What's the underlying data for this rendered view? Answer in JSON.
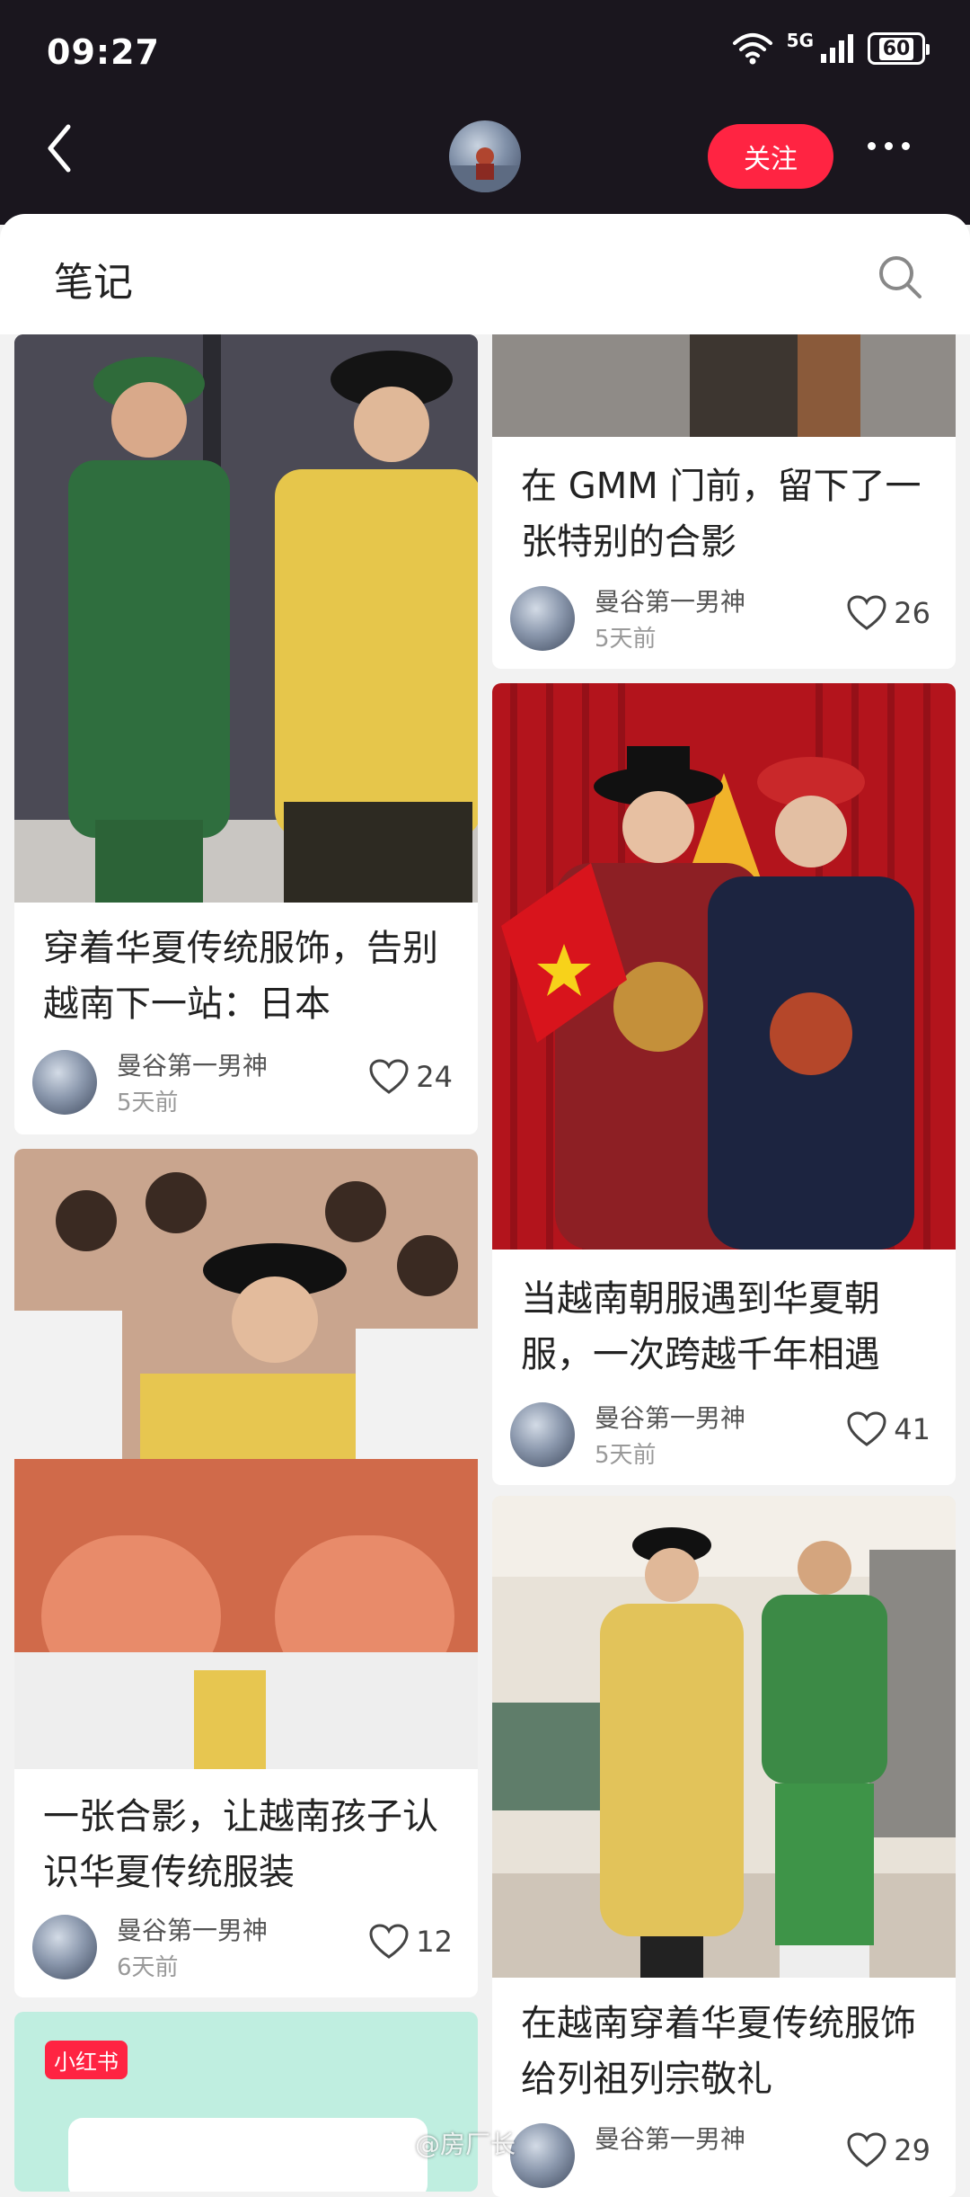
{
  "status_bar": {
    "time": "09:27",
    "network": "5G",
    "battery": "60"
  },
  "header": {
    "follow_label": "关注"
  },
  "section": {
    "title": "笔记"
  },
  "notes": [
    {
      "title": "穿着华夏传统服饰，告别越南下一站：日本",
      "author": "曼谷第一男神",
      "time": "5天前",
      "likes": "24"
    },
    {
      "title": "一张合影，让越南孩子认识华夏传统服装",
      "author": "曼谷第一男神",
      "time": "6天前",
      "likes": "12"
    },
    {
      "title": "在 GMM 门前，留下了一张特别的合影",
      "author": "曼谷第一男神",
      "time": "5天前",
      "likes": "26"
    },
    {
      "title": "当越南朝服遇到华夏朝服，一次跨越千年相遇",
      "author": "曼谷第一男神",
      "time": "5天前",
      "likes": "41"
    },
    {
      "title": "在越南穿着华夏传统服饰给列祖列宗敬礼",
      "author": "曼谷第一男神",
      "time": "",
      "likes": "29"
    }
  ],
  "promo_badge": "小红书",
  "watermark": "@房厂长",
  "colors": {
    "accent": "#ff2442",
    "topbar": "#1a161e"
  },
  "icons": [
    "back-icon",
    "search-icon",
    "more-icon",
    "heart-icon",
    "wifi-icon",
    "signal-icon"
  ]
}
